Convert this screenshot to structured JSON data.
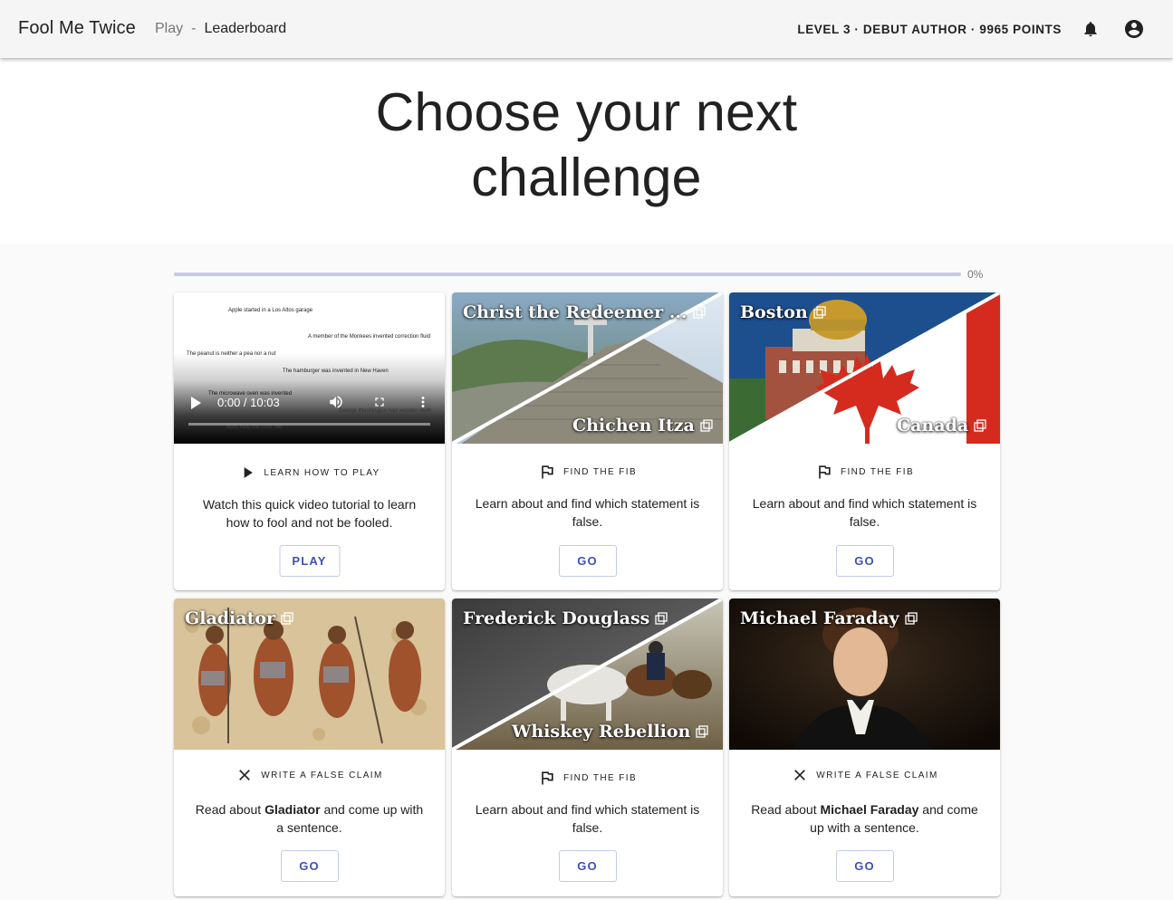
{
  "header": {
    "brand": "Fool Me Twice",
    "nav_play": "Play",
    "nav_sep": "-",
    "nav_leaderboard": "Leaderboard",
    "status": "LEVEL 3 · DEBUT AUTHOR · 9965 POINTS"
  },
  "hero": {
    "title_line1": "Choose your next",
    "title_line2": "challenge"
  },
  "progress": {
    "percent": 0,
    "label": "0%"
  },
  "video": {
    "lines": [
      "Apple started in a Los Altos garage",
      "A member of the Monkees invented correction fluid",
      "The peanut is neither a pea nor a nut",
      "The hamburger was invented in New Haven",
      "The microwave oven was invented",
      "George Washington had wooden teeth",
      "Bulls hate the color red"
    ],
    "time": "0:00 / 10:03"
  },
  "cards": [
    {
      "kind": "LEARN HOW TO PLAY",
      "desc": "Watch this quick video tutorial to learn how to fool and not be fooled.",
      "button": "PLAY"
    },
    {
      "title_a": "Christ the Redeemer ...",
      "title_b": "Chichen Itza",
      "kind": "FIND THE FIB",
      "desc": "Learn about and find which statement is false.",
      "button": "GO"
    },
    {
      "title_a": "Boston",
      "title_b": "Canada",
      "kind": "FIND THE FIB",
      "desc": "Learn about and find which statement is false.",
      "button": "GO"
    },
    {
      "title_a": "Gladiator",
      "kind": "WRITE A FALSE CLAIM",
      "desc_pre": "Read about ",
      "desc_bold": "Gladiator",
      "desc_post": " and come up with a sentence.",
      "button": "GO"
    },
    {
      "title_a": "Frederick Douglass",
      "title_b": "Whiskey Rebellion",
      "kind": "FIND THE FIB",
      "desc": "Learn about and find which statement is false.",
      "button": "GO"
    },
    {
      "title_a": "Michael Faraday",
      "kind": "WRITE A FALSE CLAIM",
      "desc_pre": "Read about ",
      "desc_bold": "Michael Faraday",
      "desc_post": " and come up with a sentence.",
      "button": "GO"
    }
  ],
  "icons": {
    "bell": "bell-icon",
    "account": "account-circle-icon",
    "play": "play-arrow-icon",
    "flag": "flag-icon",
    "close": "close-x-icon",
    "external": "open-in-new-icon"
  },
  "colors": {
    "accent": "#3f51b5",
    "progress_track": "#c5cae9",
    "canada_red": "#d52b1e"
  }
}
